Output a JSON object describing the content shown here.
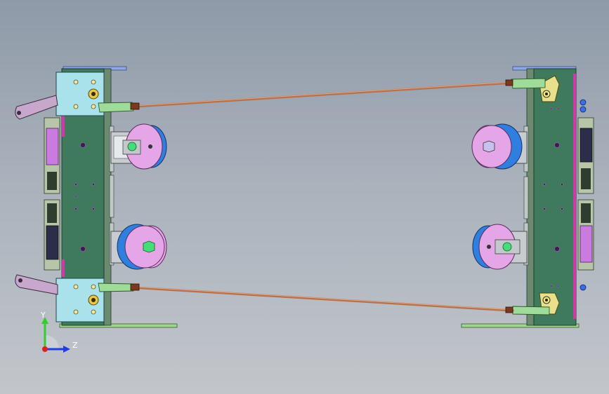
{
  "view": {
    "background_top": "#8f9aa8",
    "background_bottom": "#c2c6cb"
  },
  "triad": {
    "y_label": "Y",
    "z_label": "Z",
    "y_color": "#33cc33",
    "z_color": "#1f3fe0",
    "x_color": "#e02020"
  },
  "parts": {
    "frame_color": "#3f7a5c",
    "bracket_color": "#a9e2ea",
    "lever_color": "#c7a8cc",
    "linkage_color": "#b5724f",
    "clevis_color": "#9fdc9a",
    "pulley_blue": "#2f7fe0",
    "pulley_pink": "#e4a6e6",
    "damper_color": "#c97be0",
    "base_plate_color": "#9fd88c"
  }
}
